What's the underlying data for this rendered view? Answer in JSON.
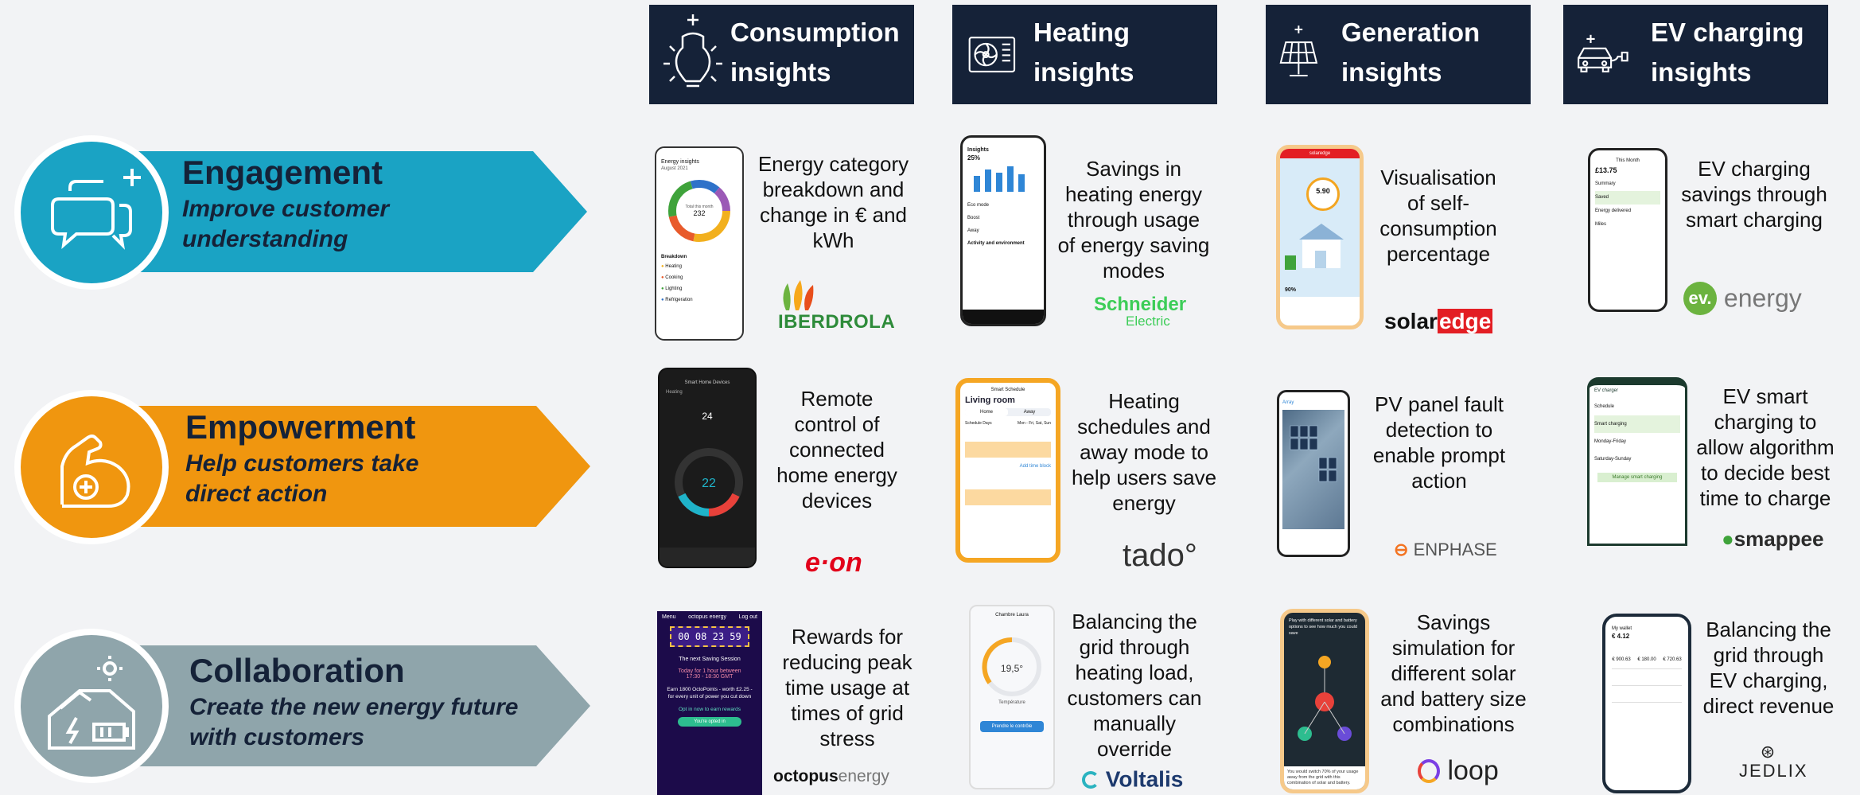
{
  "columns": [
    {
      "title_l1": "Consumption",
      "title_l2": "insights",
      "icon": "lightbulb-icon"
    },
    {
      "title_l1": "Heating",
      "title_l2": "insights",
      "icon": "heat-pump-icon"
    },
    {
      "title_l1": "Generation",
      "title_l2": "insights",
      "icon": "solar-panel-icon"
    },
    {
      "title_l1": "EV charging",
      "title_l2": "insights",
      "icon": "ev-car-icon"
    }
  ],
  "rows": [
    {
      "title": "Engagement",
      "subtitle_l1": "Improve customer",
      "subtitle_l2": "understanding",
      "color": "#1aa3c4",
      "icon": "chat-bubbles-icon"
    },
    {
      "title": "Empowerment",
      "subtitle_l1": "Help customers take",
      "subtitle_l2": "direct action",
      "color": "#f0960f",
      "icon": "flexed-arm-icon"
    },
    {
      "title": "Collaboration",
      "subtitle_l1": "Create the new energy future",
      "subtitle_l2": "with customers",
      "color": "#8fa5ab",
      "icon": "solar-house-battery-icon"
    }
  ],
  "cells": [
    {
      "desc": [
        "Energy category",
        "breakdown and",
        "change in € and",
        "kWh"
      ],
      "logo": "IBERDROLA",
      "screen": {
        "header": "Energy insights",
        "period": "August 2021",
        "center_label": "Total this month",
        "center_value": "232",
        "section": "Breakdown",
        "items": [
          "Heating",
          "Cooking",
          "Lighting",
          "Refrigeration"
        ]
      }
    },
    {
      "desc": [
        "Savings in",
        "heating energy",
        "through usage",
        "of energy saving",
        "modes"
      ],
      "logo_l1": "Schneider",
      "logo_l2": "Electric",
      "screen": {
        "header": "Insights",
        "pct": "25%",
        "rows": [
          "Eco mode",
          "Boost",
          "Away",
          "Activity and environment"
        ]
      }
    },
    {
      "desc": [
        "Visualisation",
        "of self-",
        "consumption",
        "percentage"
      ],
      "logo_a": "solar",
      "logo_b": "edge",
      "screen": {
        "header": "solaredge",
        "value": "5.90",
        "unit": "kWh",
        "pct": "90%"
      }
    },
    {
      "desc": [
        "EV charging",
        "savings through",
        "smart charging"
      ],
      "logo_a": "ev.",
      "logo_b": "energy",
      "screen": {
        "header": "This Month",
        "value": "£13.75",
        "rows": [
          "Summary",
          "Saved",
          "Energy delivered",
          "Miles"
        ]
      }
    },
    {
      "desc": [
        "Remote",
        "control of",
        "connected",
        "home energy",
        "devices"
      ],
      "logo": "e·on",
      "screen": {
        "header": "Smart Home Devices",
        "setpoint": "24",
        "temp": "22",
        "mode": "Heating"
      }
    },
    {
      "desc": [
        "Heating",
        "schedules and",
        "away mode to",
        "help users save",
        "energy"
      ],
      "logo": "tado°",
      "screen": {
        "header": "Smart Schedule",
        "room": "Living room",
        "tab1": "Home",
        "tab2": "Away",
        "days": "Schedule Days",
        "days_val": "Mon - Fri, Sat, Sun",
        "add": "Add time block"
      }
    },
    {
      "desc": [
        "PV panel fault",
        "detection to",
        "enable prompt",
        "action"
      ],
      "logo": "ENPHASE",
      "screen": {
        "header": "Array"
      }
    },
    {
      "desc": [
        "EV smart",
        "charging to",
        "allow algorithm",
        "to decide best",
        "time to charge"
      ],
      "logo": "smappee",
      "screen": {
        "header": "EV charger",
        "rows": [
          "Schedule",
          "Smart charging",
          "Monday-Friday",
          "Saturday-Sunday"
        ],
        "button": "Manage smart charging"
      }
    },
    {
      "desc": [
        "Rewards for",
        "reducing peak",
        "time usage at",
        "times of grid",
        "stress"
      ],
      "logo_a": "octopus",
      "logo_b": "energy",
      "screen": {
        "menu": "Menu",
        "brand": "octopus energy",
        "logout": "Log out",
        "timer": "00 08 23 59",
        "title": "The next Saving Session",
        "when": "Today for 1 hour between",
        "time": "17:30 - 18:30 GMT",
        "earn": "Earn 1800 OctoPoints - worth £2.25 - for every unit of power you cut down",
        "opt": "Opt in now to earn rewards",
        "btn": "You're opted in"
      }
    },
    {
      "desc": [
        "Balancing the",
        "grid through",
        "heating load,",
        "customers can",
        "manually",
        "override"
      ],
      "logo": "Voltalis",
      "screen": {
        "room": "Chambre Laura",
        "temp": "19,5°",
        "label": "Température",
        "btn": "Prendre le contrôle"
      }
    },
    {
      "desc": [
        "Savings",
        "simulation for",
        "different solar",
        "and battery size",
        "combinations"
      ],
      "logo": "loop",
      "screen": {
        "text": "Play with different solar and battery options to see how much you could save",
        "footer": "You would switch 70% of your usage away from the grid with this combination of solar and battery."
      }
    },
    {
      "desc": [
        "Balancing the",
        "grid through",
        "EV charging,",
        "direct revenue"
      ],
      "logo": "JEDLIX",
      "screen": {
        "header": "My wallet",
        "value": "€ 4.12",
        "rows": [
          "€ 900.63",
          "€ 180.00",
          "€ 720.63"
        ]
      }
    }
  ]
}
